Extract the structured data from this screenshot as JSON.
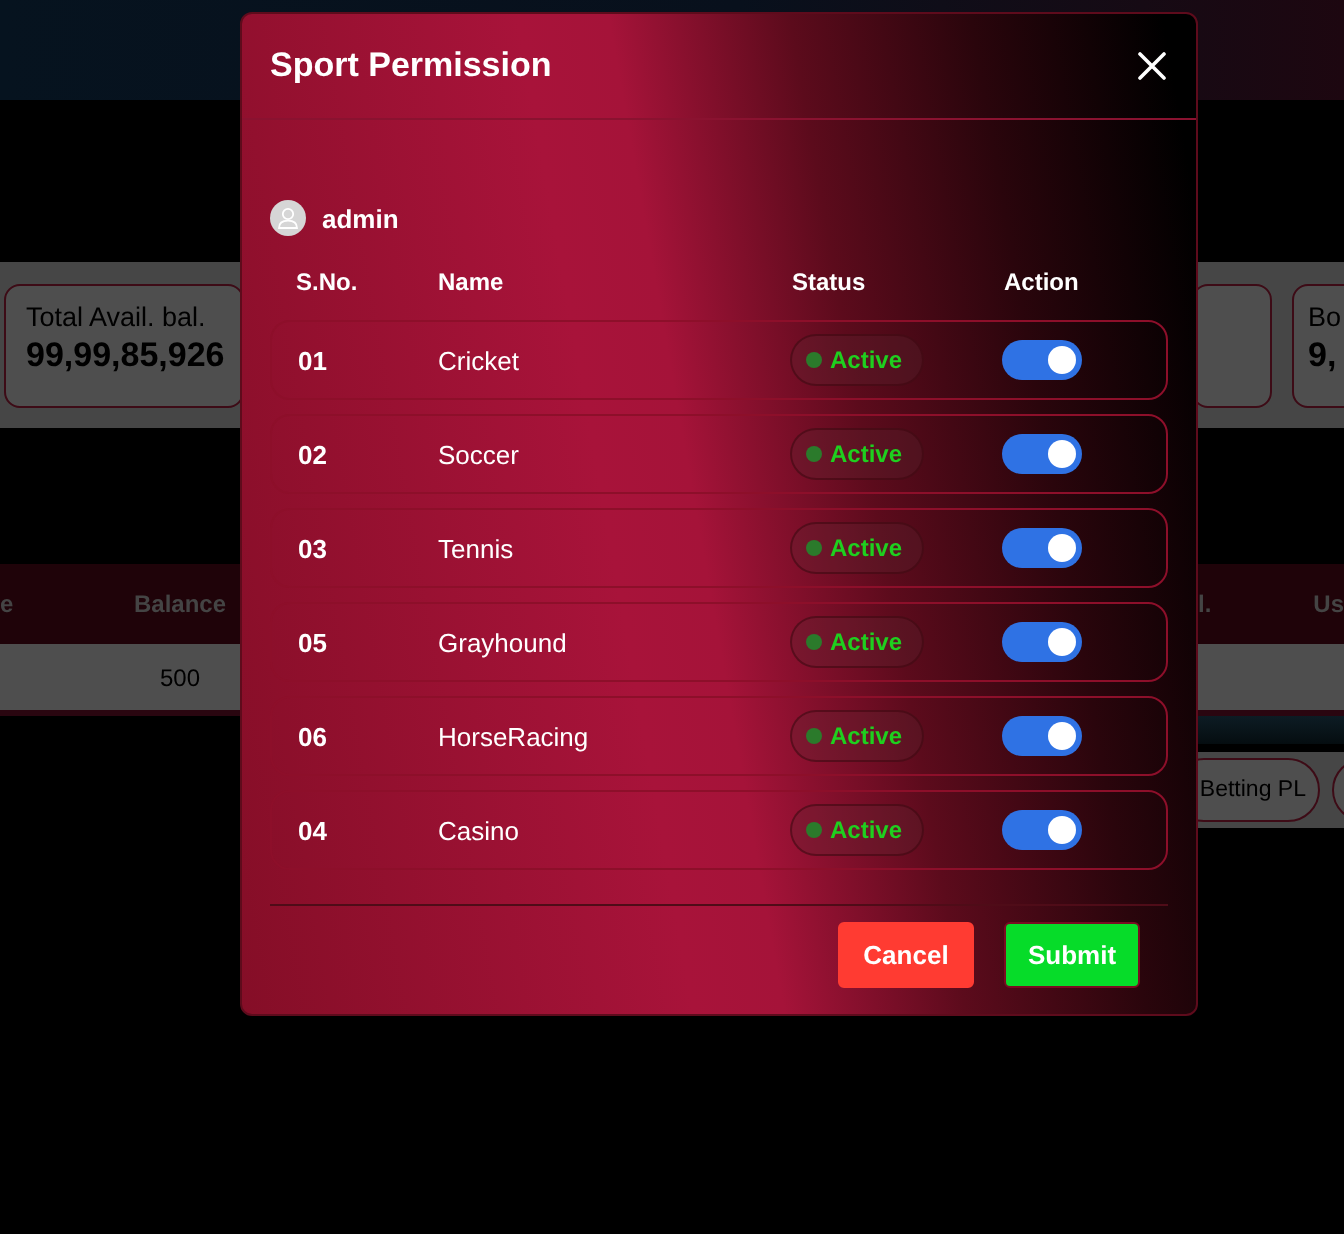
{
  "background": {
    "summary_cards": [
      {
        "label": "Total Avail. bal.",
        "value": "99,99,85,926"
      },
      {
        "label": "Bo",
        "value": "9,"
      }
    ],
    "table": {
      "left_columns": [
        "e",
        "Balance"
      ],
      "right_columns": [
        "l.",
        "Us"
      ],
      "row_cells": [
        "500"
      ]
    },
    "report_buttons": [
      {
        "label": "Betting PL"
      }
    ]
  },
  "modal": {
    "title": "Sport Permission",
    "user": "admin",
    "columns": [
      "S.No.",
      "Name",
      "Status",
      "Action"
    ],
    "rows": [
      {
        "sno": "01",
        "name": "Cricket",
        "status": "Active",
        "on": true
      },
      {
        "sno": "02",
        "name": "Soccer",
        "status": "Active",
        "on": true
      },
      {
        "sno": "03",
        "name": "Tennis",
        "status": "Active",
        "on": true
      },
      {
        "sno": "05",
        "name": "Grayhound",
        "status": "Active",
        "on": true
      },
      {
        "sno": "06",
        "name": "HorseRacing",
        "status": "Active",
        "on": true
      },
      {
        "sno": "04",
        "name": "Casino",
        "status": "Active",
        "on": true
      }
    ],
    "buttons": [
      {
        "label": "Cancel",
        "kind": "cancel"
      },
      {
        "label": "Submit",
        "kind": "submit"
      }
    ]
  }
}
